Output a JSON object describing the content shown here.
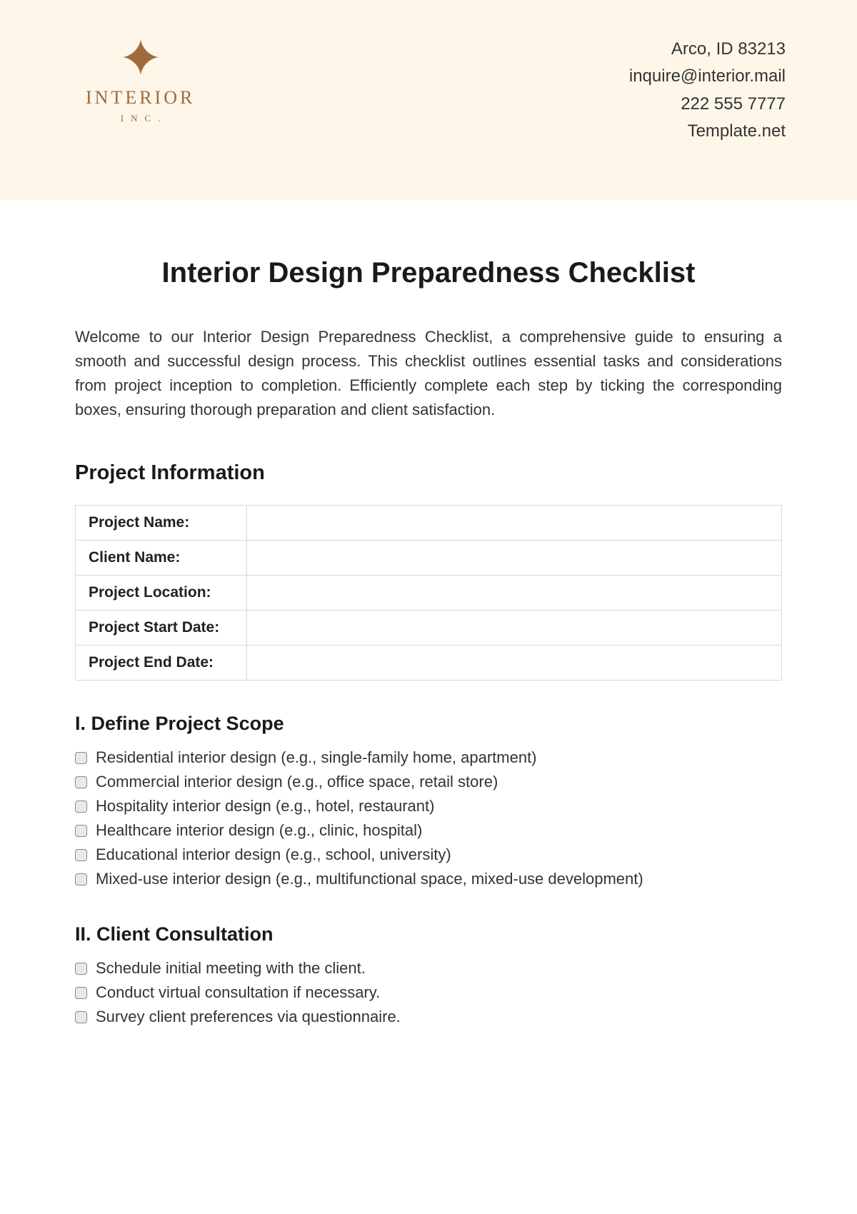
{
  "header": {
    "logo_name": "INTERIOR",
    "logo_sub": "INC.",
    "contact": {
      "address": "Arco, ID 83213",
      "email": "inquire@interior.mail",
      "phone": "222 555 7777",
      "site": "Template.net"
    }
  },
  "title": "Interior Design Preparedness Checklist",
  "intro": "Welcome to our Interior Design Preparedness Checklist, a comprehensive guide to ensuring a smooth and successful design process. This checklist outlines essential tasks and considerations from project inception to completion. Efficiently complete each step by ticking the corresponding boxes, ensuring thorough preparation and client satisfaction.",
  "section_info": {
    "heading": "Project Information",
    "fields": [
      {
        "label": "Project Name:",
        "value": ""
      },
      {
        "label": "Client Name:",
        "value": ""
      },
      {
        "label": "Project Location:",
        "value": ""
      },
      {
        "label": "Project Start Date:",
        "value": ""
      },
      {
        "label": "Project End Date:",
        "value": ""
      }
    ]
  },
  "section_scope": {
    "heading": "I. Define Project Scope",
    "items": [
      "Residential interior design (e.g., single-family home, apartment)",
      "Commercial interior design (e.g., office space, retail store)",
      "Hospitality interior design (e.g., hotel, restaurant)",
      "Healthcare interior design (e.g., clinic, hospital)",
      "Educational interior design (e.g., school, university)",
      "Mixed-use interior design (e.g., multifunctional space, mixed-use development)"
    ]
  },
  "section_client": {
    "heading": "II. Client Consultation",
    "items": [
      "Schedule initial meeting with the client.",
      "Conduct virtual consultation if necessary.",
      "Survey client preferences via questionnaire."
    ]
  }
}
